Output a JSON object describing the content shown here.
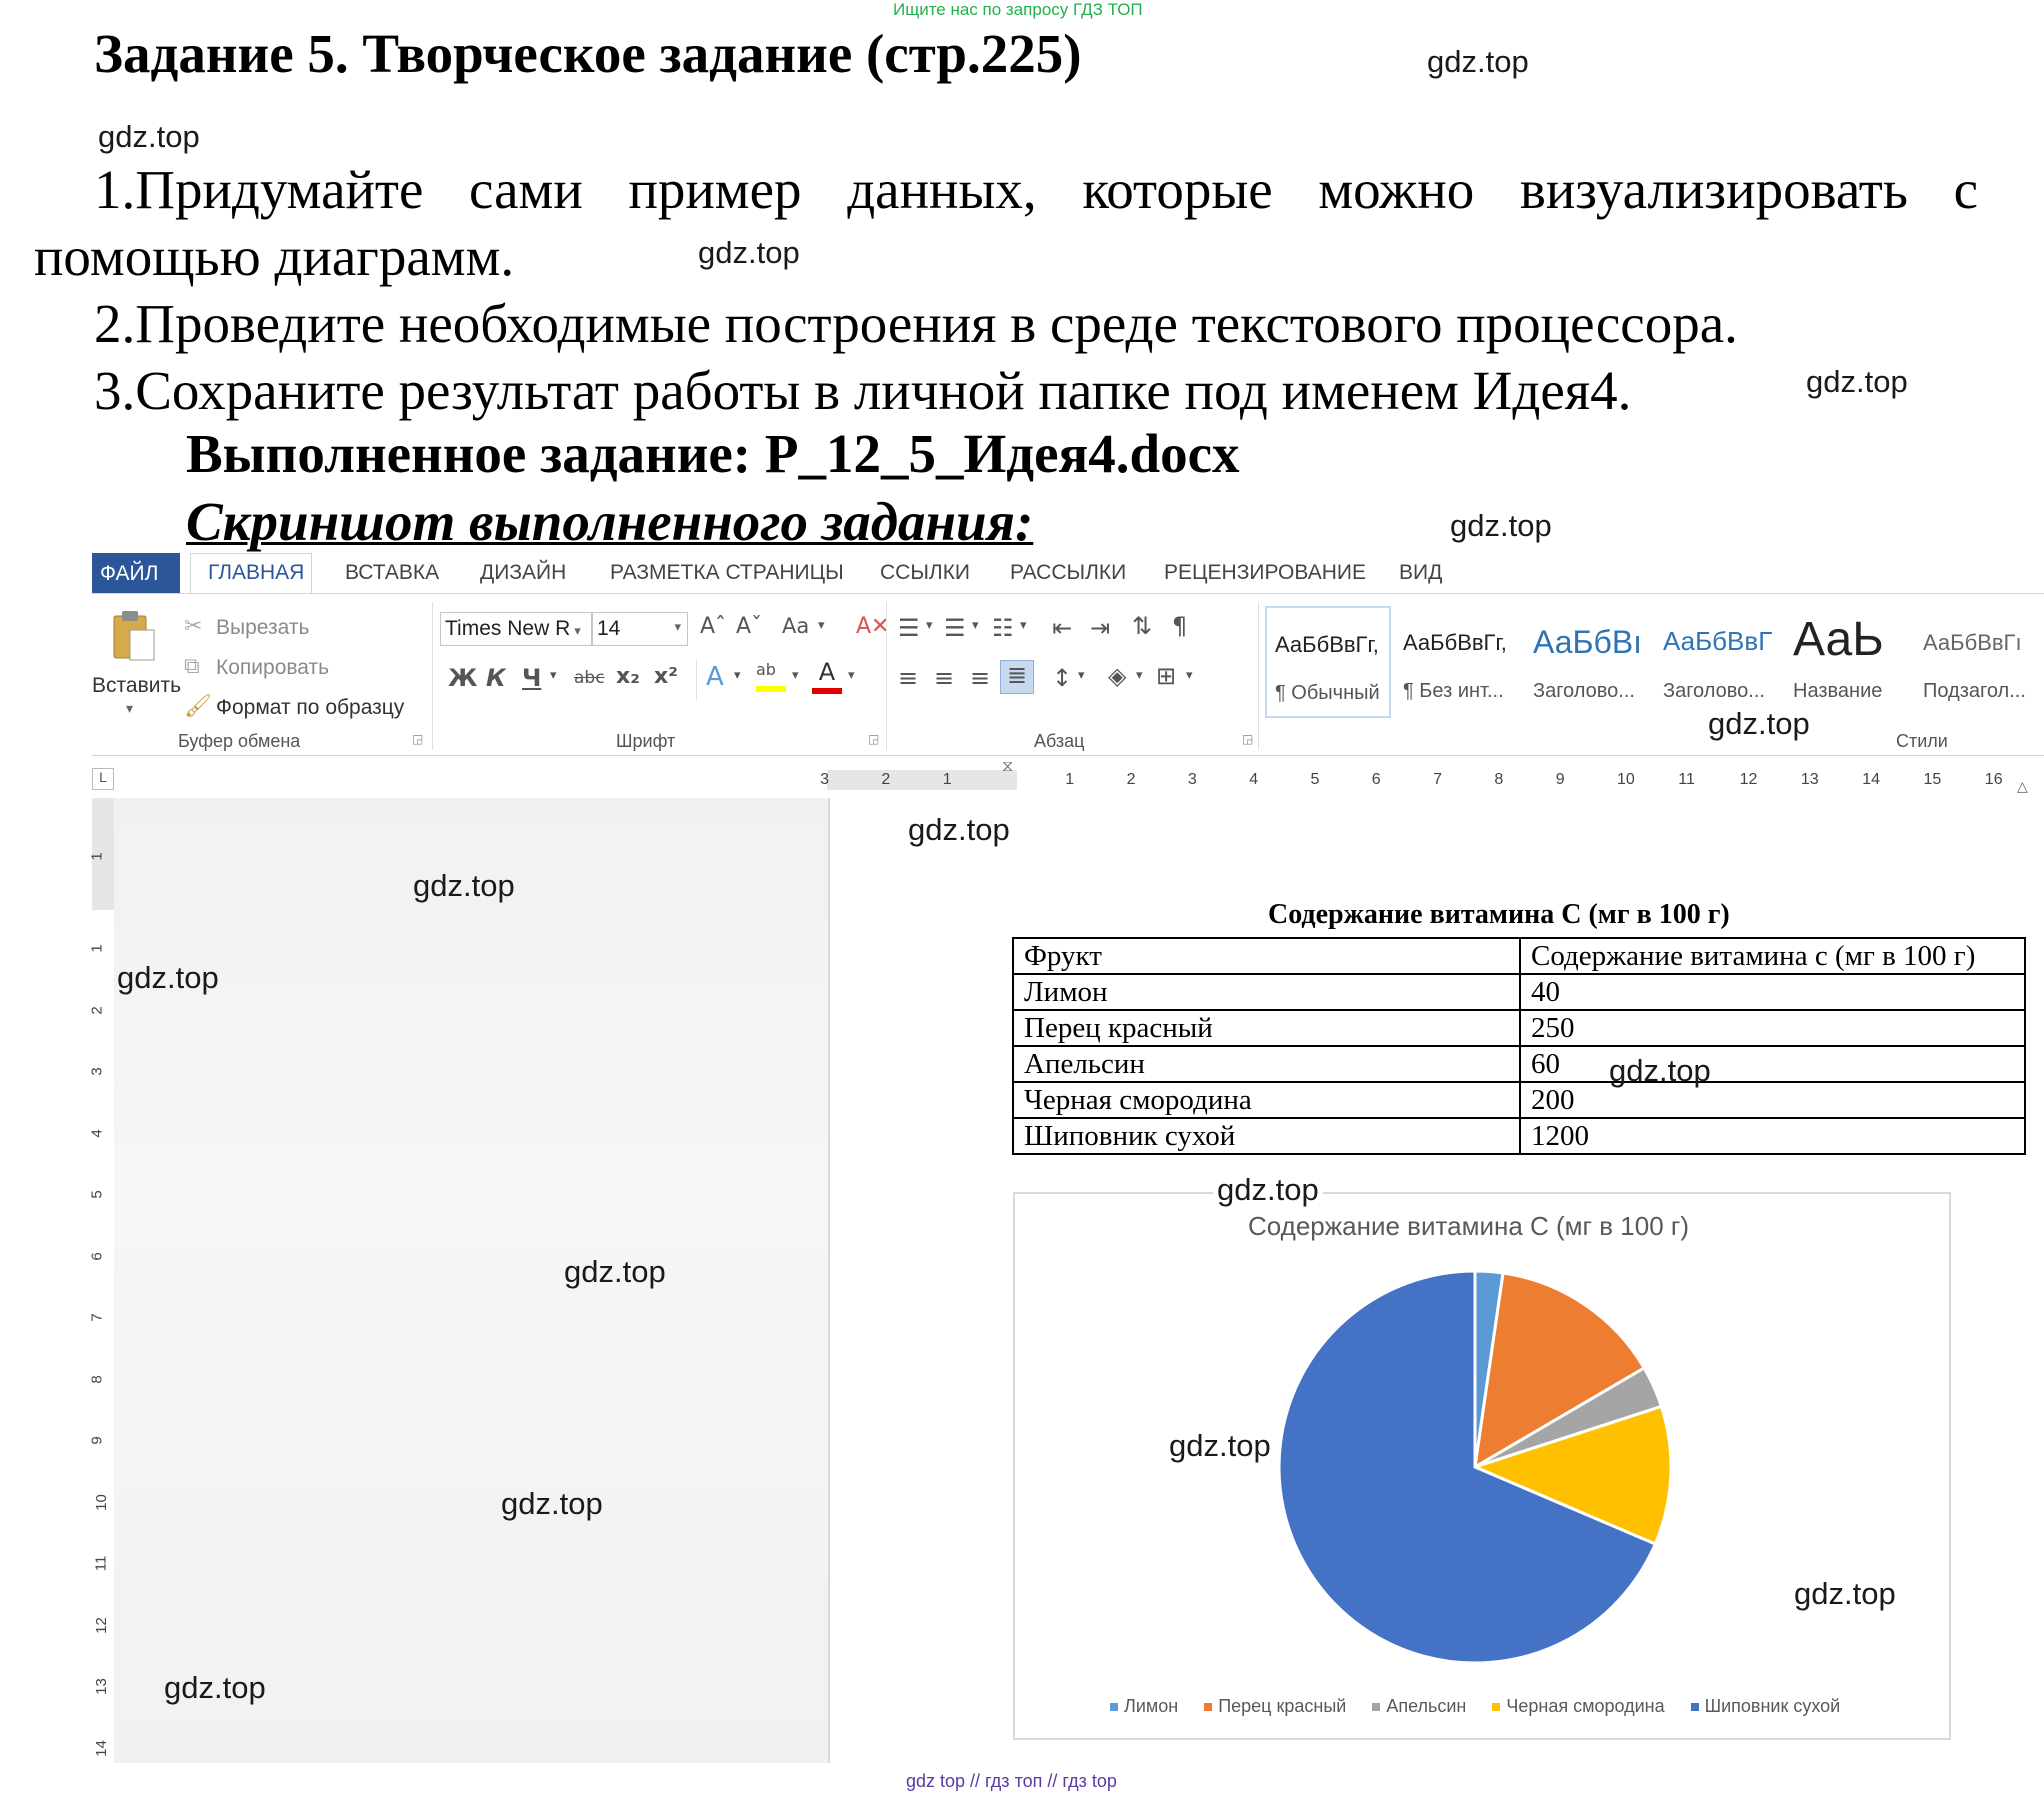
{
  "header_note": "Ищите нас по запросу ГДЗ ТОП",
  "title": "Задание 5. Творческое задание (стр.225)",
  "task": {
    "item1_line1": "1.Придумайте сами пример данных, которые можно визуализировать с",
    "item1_line2": "помощью диаграмм.",
    "item2": "2.Проведите необходимые построения в среде текстового процессора.",
    "item3": "3.Сохраните результат работы в личной папке под именем Идея4."
  },
  "done_label": "Выполненное задание: Р_12_5_Идея4.docx",
  "screenshot_label": "Скриншот выполненного задания:",
  "watermark": "gdz.top",
  "footer_note": "gdz top // гдз топ // гдз top",
  "word": {
    "tabs": [
      "ФАЙЛ",
      "ГЛАВНАЯ",
      "ВСТАВКА",
      "ДИЗАЙН",
      "РАЗМЕТКА СТРАНИЦЫ",
      "ССЫЛКИ",
      "РАССЫЛКИ",
      "РЕЦЕНЗИРОВАНИЕ",
      "ВИД"
    ],
    "clipboard": {
      "paste": "Вставить",
      "cut": "Вырезать",
      "copy": "Копировать",
      "format_painter": "Формат по образцу",
      "group": "Буфер обмена"
    },
    "font": {
      "family": "Times New R",
      "size": "14",
      "group": "Шрифт",
      "bold": "Ж",
      "italic": "К",
      "underline": "Ч",
      "strike": "abc",
      "sub": "x₂",
      "sup": "x²",
      "case": "Aa"
    },
    "paragraph_group": "Абзац",
    "styles": {
      "group": "Стили",
      "items": [
        {
          "sample": "АаБбВвГг,",
          "name": "¶ Обычный"
        },
        {
          "sample": "АаБбВвГг,",
          "name": "¶ Без инт..."
        },
        {
          "sample": "АаБбВı",
          "name": "Заголово..."
        },
        {
          "sample": "АаБбВвГ",
          "name": "Заголово..."
        },
        {
          "sample": "АаЬ",
          "name": "Название"
        },
        {
          "sample": "АаБбВвГı",
          "name": "Подзагол..."
        }
      ]
    },
    "ruler_h": [
      "3",
      "2",
      "1",
      "1",
      "2",
      "3",
      "4",
      "5",
      "6",
      "7",
      "8",
      "9",
      "10",
      "11",
      "12",
      "13",
      "14",
      "15",
      "16"
    ],
    "ruler_v": [
      "1",
      "1",
      "2",
      "3",
      "4",
      "5",
      "6",
      "7",
      "8",
      "9",
      "10",
      "11",
      "12",
      "13",
      "14"
    ]
  },
  "table": {
    "title": "Содержание витамина С (мг в 100 г)",
    "header": [
      "Фрукт",
      "Содержание витамина с (мг в 100 г)"
    ],
    "rows": [
      [
        "Лимон",
        "40"
      ],
      [
        "Перец красный",
        "250"
      ],
      [
        "Апельсин",
        "60"
      ],
      [
        "Черная смородина",
        "200"
      ],
      [
        "Шиповник сухой",
        "1200"
      ]
    ]
  },
  "chart_data": {
    "type": "pie",
    "title": "Содержание витамина С (мг в 100 г)",
    "categories": [
      "Лимон",
      "Перец красный",
      "Апельсин",
      "Черная смородина",
      "Шиповник сухой"
    ],
    "values": [
      40,
      250,
      60,
      200,
      1200
    ],
    "colors": [
      "#5b9bd5",
      "#ed7d31",
      "#a5a5a5",
      "#ffc000",
      "#4472c4"
    ],
    "legend": "bottom"
  }
}
